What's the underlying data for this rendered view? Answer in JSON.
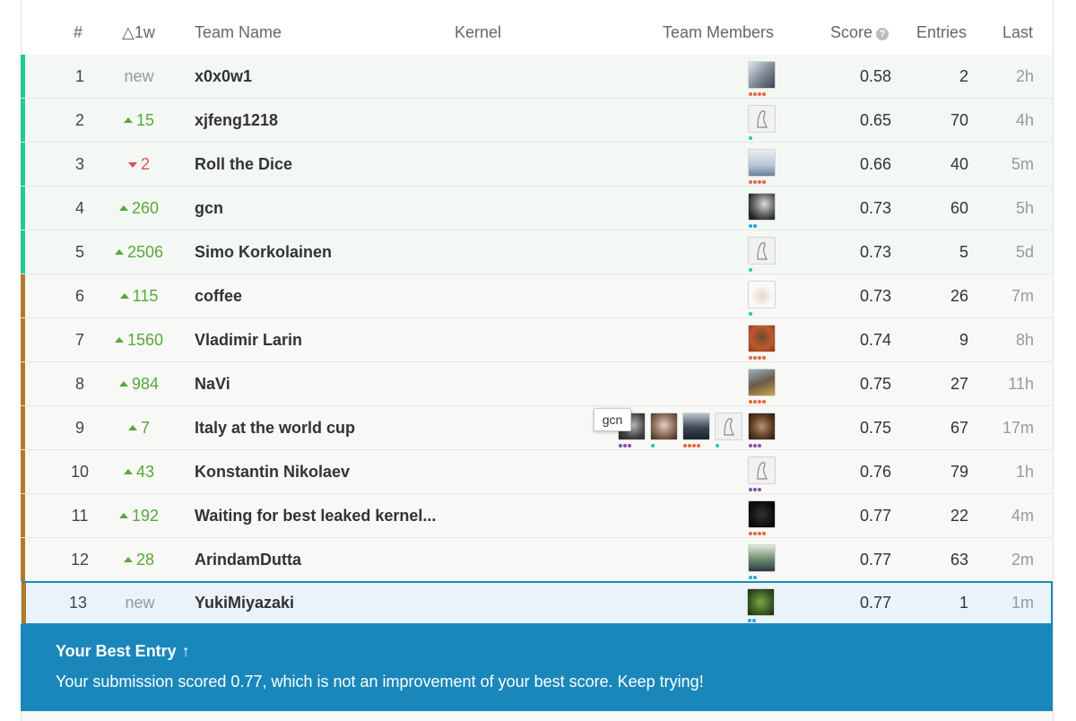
{
  "header": {
    "rank": "#",
    "delta": "△1w",
    "team_name": "Team Name",
    "kernel": "Kernel",
    "team_members": "Team Members",
    "score": "Score",
    "entries": "Entries",
    "last": "Last"
  },
  "colors": {
    "silver_stripe": "#20c997",
    "gold_stripe": "#b07a2a",
    "banner": "#1a87bb",
    "up": "#58a83a",
    "down": "#d9534f"
  },
  "rows": [
    {
      "rank": "1",
      "delta": "new",
      "dir": "new",
      "name": "x0x0w1",
      "score": "0.58",
      "entries": "2",
      "last": "2h"
    },
    {
      "rank": "2",
      "delta": "15",
      "dir": "up",
      "name": "xjfeng1218",
      "score": "0.65",
      "entries": "70",
      "last": "4h"
    },
    {
      "rank": "3",
      "delta": "2",
      "dir": "down",
      "name": "Roll the Dice",
      "score": "0.66",
      "entries": "40",
      "last": "5m"
    },
    {
      "rank": "4",
      "delta": "260",
      "dir": "up",
      "name": "gcn",
      "score": "0.73",
      "entries": "60",
      "last": "5h"
    },
    {
      "rank": "5",
      "delta": "2506",
      "dir": "up",
      "name": "Simo Korkolainen",
      "score": "0.73",
      "entries": "5",
      "last": "5d"
    },
    {
      "rank": "6",
      "delta": "115",
      "dir": "up",
      "name": "coffee",
      "score": "0.73",
      "entries": "26",
      "last": "7m"
    },
    {
      "rank": "7",
      "delta": "1560",
      "dir": "up",
      "name": "Vladimir Larin",
      "score": "0.74",
      "entries": "9",
      "last": "8h"
    },
    {
      "rank": "8",
      "delta": "984",
      "dir": "up",
      "name": "NaVi",
      "score": "0.75",
      "entries": "27",
      "last": "11h"
    },
    {
      "rank": "9",
      "delta": "7",
      "dir": "up",
      "name": "Italy at the world cup",
      "score": "0.75",
      "entries": "67",
      "last": "17m"
    },
    {
      "rank": "10",
      "delta": "43",
      "dir": "up",
      "name": "Konstantin Nikolaev",
      "score": "0.76",
      "entries": "79",
      "last": "1h"
    },
    {
      "rank": "11",
      "delta": "192",
      "dir": "up",
      "name": "Waiting for best leaked kernel...",
      "score": "0.77",
      "entries": "22",
      "last": "4m"
    },
    {
      "rank": "12",
      "delta": "28",
      "dir": "up",
      "name": "ArindamDutta",
      "score": "0.77",
      "entries": "63",
      "last": "2m"
    },
    {
      "rank": "13",
      "delta": "new",
      "dir": "new",
      "name": "YukiMiyazaki",
      "score": "0.77",
      "entries": "1",
      "last": "1m"
    }
  ],
  "tooltip": "gcn",
  "banner": {
    "title": "Your Best Entry",
    "message": "Your submission scored 0.77, which is not an improvement of your best score. Keep trying!"
  }
}
